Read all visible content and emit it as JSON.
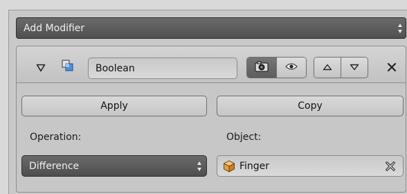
{
  "add_modifier": {
    "label": "Add Modifier",
    "icon": "updown-arrows-icon"
  },
  "modifier": {
    "name": "Boolean",
    "type_icon": "boolean-modifier-icon",
    "collapse_icon": "triangle-down-icon",
    "render_buttons": [
      {
        "icon": "camera-icon",
        "active": true
      },
      {
        "icon": "eye-icon",
        "active": false
      }
    ],
    "move_buttons": [
      {
        "icon": "move-up-icon"
      },
      {
        "icon": "move-down-icon"
      }
    ],
    "delete_icon": "close-icon",
    "apply_label": "Apply",
    "copy_label": "Copy",
    "operation_label": "Operation:",
    "operation_value": "Difference",
    "object_label": "Object:",
    "object_value": "Finger",
    "object_icon": "cube-icon"
  },
  "colors": {
    "panel": "#c7c7c7",
    "dark_widget": "#595959",
    "object_cube": "#e8a040"
  }
}
